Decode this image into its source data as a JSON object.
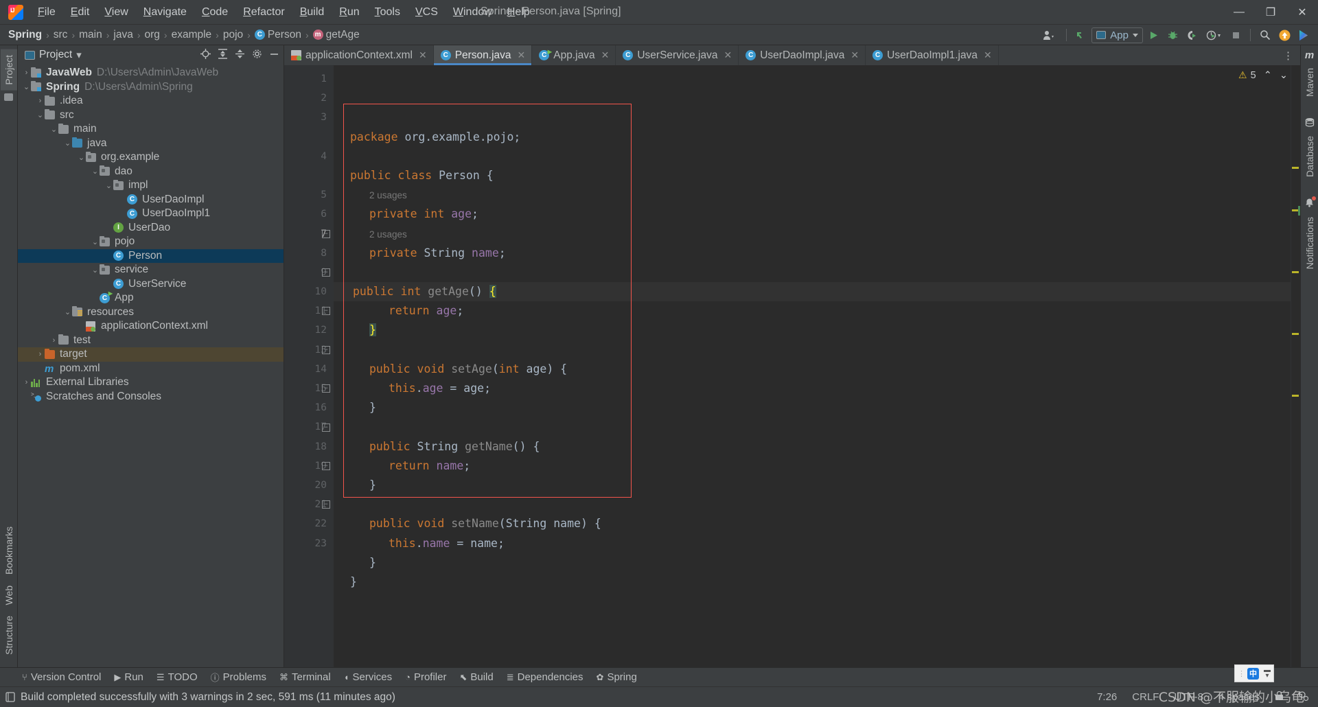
{
  "titlebar": {
    "logo": "intellij-idea-logo",
    "window_title": "Spring - Person.java [Spring]",
    "menus": [
      "File",
      "Edit",
      "View",
      "Navigate",
      "Code",
      "Refactor",
      "Build",
      "Run",
      "Tools",
      "VCS",
      "Window",
      "Help"
    ],
    "minimize": "—",
    "maximize": "❐",
    "close": "✕"
  },
  "navbar": {
    "breadcrumb": [
      {
        "label": "Spring",
        "bold": true,
        "icon": ""
      },
      {
        "label": "src",
        "bold": false,
        "icon": ""
      },
      {
        "label": "main",
        "bold": false,
        "icon": ""
      },
      {
        "label": "java",
        "bold": false,
        "icon": ""
      },
      {
        "label": "org",
        "bold": false,
        "icon": ""
      },
      {
        "label": "example",
        "bold": false,
        "icon": ""
      },
      {
        "label": "pojo",
        "bold": false,
        "icon": ""
      },
      {
        "label": "Person",
        "bold": false,
        "icon": "class-icon",
        "icon_char": "C"
      },
      {
        "label": "getAge",
        "bold": false,
        "icon": "method-icon",
        "icon_char": "m"
      }
    ],
    "separator": "›",
    "toolbar": {
      "account_icon": "user-account-icon",
      "update_icon": "vcs-update-icon",
      "run_config_label": "App",
      "run_icon": "run-icon",
      "debug_icon": "debug-icon",
      "coverage_icon": "run-with-coverage-icon",
      "profiler_icon": "profiler-icon",
      "stop_icon": "stop-icon",
      "search_icon": "search-everywhere-icon",
      "updates_icon": "updates-available-icon",
      "ai_icon": "ai-assistant-icon"
    }
  },
  "left_strip": {
    "tabs": [
      {
        "label": "Project",
        "active": true,
        "icon": "project-icon"
      },
      {
        "label": "Bookmarks",
        "active": false,
        "icon": "bookmark-icon"
      },
      {
        "label": "Web",
        "active": false,
        "icon": "web-icon"
      },
      {
        "label": "Structure",
        "active": false,
        "icon": "structure-icon"
      }
    ]
  },
  "right_strip": {
    "tabs": [
      {
        "label": "Maven",
        "icon": "maven-icon"
      },
      {
        "label": "Database",
        "icon": "database-icon"
      },
      {
        "label": "Notifications",
        "icon": "notifications-icon"
      }
    ]
  },
  "project_panel": {
    "title": "Project",
    "dropdown_caret": "▾",
    "actions": [
      "locate-icon",
      "expand-all-icon",
      "collapse-all-icon",
      "settings-icon",
      "hide-icon"
    ],
    "tree": [
      {
        "indent": 0,
        "arrow": "›",
        "icon": "module-folder-icon",
        "name": "JavaWeb",
        "bold": true,
        "path": "D:\\Users\\Admin\\JavaWeb",
        "state": "normal"
      },
      {
        "indent": 0,
        "arrow": "⌄",
        "icon": "module-folder-icon",
        "name": "Spring",
        "bold": true,
        "path": "D:\\Users\\Admin\\Spring",
        "state": "normal"
      },
      {
        "indent": 1,
        "arrow": "›",
        "icon": "folder-icon",
        "name": ".idea",
        "bold": false,
        "path": "",
        "state": "normal"
      },
      {
        "indent": 1,
        "arrow": "⌄",
        "icon": "folder-icon",
        "name": "src",
        "bold": false,
        "path": "",
        "state": "normal"
      },
      {
        "indent": 2,
        "arrow": "⌄",
        "icon": "folder-icon",
        "name": "main",
        "bold": false,
        "path": "",
        "state": "normal"
      },
      {
        "indent": 3,
        "arrow": "⌄",
        "icon": "source-folder-icon",
        "name": "java",
        "bold": false,
        "path": "",
        "state": "normal"
      },
      {
        "indent": 4,
        "arrow": "⌄",
        "icon": "package-icon",
        "name": "org.example",
        "bold": false,
        "path": "",
        "state": "normal"
      },
      {
        "indent": 5,
        "arrow": "⌄",
        "icon": "package-icon",
        "name": "dao",
        "bold": false,
        "path": "",
        "state": "normal"
      },
      {
        "indent": 6,
        "arrow": "⌄",
        "icon": "package-icon",
        "name": "impl",
        "bold": false,
        "path": "",
        "state": "normal"
      },
      {
        "indent": 7,
        "arrow": "",
        "icon": "class-icon",
        "name": "UserDaoImpl",
        "bold": false,
        "path": "",
        "state": "normal"
      },
      {
        "indent": 7,
        "arrow": "",
        "icon": "class-icon",
        "name": "UserDaoImpl1",
        "bold": false,
        "path": "",
        "state": "normal"
      },
      {
        "indent": 6,
        "arrow": "",
        "icon": "interface-icon",
        "name": "UserDao",
        "bold": false,
        "path": "",
        "state": "normal"
      },
      {
        "indent": 5,
        "arrow": "⌄",
        "icon": "package-icon",
        "name": "pojo",
        "bold": false,
        "path": "",
        "state": "normal"
      },
      {
        "indent": 6,
        "arrow": "",
        "icon": "class-icon",
        "name": "Person",
        "bold": false,
        "path": "",
        "state": "selected"
      },
      {
        "indent": 5,
        "arrow": "⌄",
        "icon": "package-icon",
        "name": "service",
        "bold": false,
        "path": "",
        "state": "normal"
      },
      {
        "indent": 6,
        "arrow": "",
        "icon": "class-icon",
        "name": "UserService",
        "bold": false,
        "path": "",
        "state": "normal"
      },
      {
        "indent": 5,
        "arrow": "",
        "icon": "runnable-class-icon",
        "name": "App",
        "bold": false,
        "path": "",
        "state": "normal"
      },
      {
        "indent": 3,
        "arrow": "⌄",
        "icon": "resources-folder-icon",
        "name": "resources",
        "bold": false,
        "path": "",
        "state": "normal"
      },
      {
        "indent": 4,
        "arrow": "",
        "icon": "spring-xml-icon",
        "name": "applicationContext.xml",
        "bold": false,
        "path": "",
        "state": "normal"
      },
      {
        "indent": 2,
        "arrow": "›",
        "icon": "folder-icon",
        "name": "test",
        "bold": false,
        "path": "",
        "state": "normal"
      },
      {
        "indent": 1,
        "arrow": "›",
        "icon": "excluded-folder-icon",
        "name": "target",
        "bold": false,
        "path": "",
        "state": "highlight"
      },
      {
        "indent": 1,
        "arrow": "",
        "icon": "maven-pom-icon",
        "name": "pom.xml",
        "bold": false,
        "path": "",
        "state": "normal"
      },
      {
        "indent": 0,
        "arrow": "›",
        "icon": "external-libraries-icon",
        "name": "External Libraries",
        "bold": false,
        "path": "",
        "state": "normal"
      },
      {
        "indent": 0,
        "arrow": "",
        "icon": "scratches-icon",
        "name": "Scratches and Consoles",
        "bold": false,
        "path": "",
        "state": "normal"
      }
    ]
  },
  "editor": {
    "tabs": [
      {
        "label": "applicationContext.xml",
        "icon": "spring-xml-icon",
        "active": false,
        "close": "✕"
      },
      {
        "label": "Person.java",
        "icon": "class-icon",
        "active": true,
        "close": "✕"
      },
      {
        "label": "App.java",
        "icon": "runnable-class-icon",
        "active": false,
        "close": "✕"
      },
      {
        "label": "UserService.java",
        "icon": "class-icon",
        "active": false,
        "close": "✕"
      },
      {
        "label": "UserDaoImpl.java",
        "icon": "class-icon",
        "active": false,
        "close": "✕"
      },
      {
        "label": "UserDaoImpl1.java",
        "icon": "class-icon",
        "active": false,
        "close": "✕"
      }
    ],
    "more_icon": "⋮",
    "warnings": {
      "count": "5",
      "icon": "warning-triangle-icon",
      "up": "⌃",
      "down": "⌄"
    },
    "line_numbers": [
      "1",
      "2",
      "3",
      "4",
      "5",
      "6",
      "7",
      "8",
      "9",
      "10",
      "11",
      "12",
      "13",
      "14",
      "15",
      "16",
      "17",
      "18",
      "19",
      "20",
      "21",
      "22",
      "23"
    ],
    "code_lines": [
      {
        "n": 1,
        "indent": 0,
        "tokens": [
          {
            "t": "package",
            "c": "kw"
          },
          {
            "t": " org.example.pojo;",
            "c": "plain"
          }
        ]
      },
      {
        "n": 2,
        "indent": 0,
        "tokens": []
      },
      {
        "n": 3,
        "indent": 0,
        "tokens": [
          {
            "t": "public class",
            "c": "kw"
          },
          {
            "t": " Person {",
            "c": "plain"
          }
        ]
      },
      {
        "n": null,
        "indent": 1,
        "usage": "2 usages"
      },
      {
        "n": 4,
        "indent": 1,
        "tokens": [
          {
            "t": "private int",
            "c": "kw"
          },
          {
            "t": " ",
            "c": "plain"
          },
          {
            "t": "age",
            "c": "fld"
          },
          {
            "t": ";",
            "c": "plain"
          }
        ]
      },
      {
        "n": null,
        "indent": 1,
        "usage": "2 usages"
      },
      {
        "n": 5,
        "indent": 1,
        "tokens": [
          {
            "t": "private",
            "c": "kw"
          },
          {
            "t": " String ",
            "c": "plain"
          },
          {
            "t": "name",
            "c": "fld"
          },
          {
            "t": ";",
            "c": "plain"
          }
        ]
      },
      {
        "n": 6,
        "indent": 0,
        "tokens": []
      },
      {
        "n": 7,
        "indent": 1,
        "current": true,
        "tokens": [
          {
            "t": "public int",
            "c": "kw"
          },
          {
            "t": " ",
            "c": "plain"
          },
          {
            "t": "getAge",
            "c": "mth-dim"
          },
          {
            "t": "() ",
            "c": "plain"
          },
          {
            "t": "{",
            "c": "brace"
          }
        ]
      },
      {
        "n": 8,
        "indent": 2,
        "tokens": [
          {
            "t": "return",
            "c": "kw"
          },
          {
            "t": " ",
            "c": "plain"
          },
          {
            "t": "age",
            "c": "fld"
          },
          {
            "t": ";",
            "c": "plain"
          }
        ]
      },
      {
        "n": 9,
        "indent": 1,
        "tokens": [
          {
            "t": "}",
            "c": "brace"
          }
        ]
      },
      {
        "n": 10,
        "indent": 0,
        "tokens": []
      },
      {
        "n": 11,
        "indent": 1,
        "tokens": [
          {
            "t": "public void",
            "c": "kw"
          },
          {
            "t": " ",
            "c": "plain"
          },
          {
            "t": "setAge",
            "c": "mth-dim"
          },
          {
            "t": "(",
            "c": "plain"
          },
          {
            "t": "int",
            "c": "kw"
          },
          {
            "t": " age) {",
            "c": "plain"
          }
        ]
      },
      {
        "n": 12,
        "indent": 2,
        "tokens": [
          {
            "t": "this",
            "c": "kw"
          },
          {
            "t": ".",
            "c": "plain"
          },
          {
            "t": "age",
            "c": "fld"
          },
          {
            "t": " = age;",
            "c": "plain"
          }
        ]
      },
      {
        "n": 13,
        "indent": 1,
        "tokens": [
          {
            "t": "}",
            "c": "plain"
          }
        ]
      },
      {
        "n": 14,
        "indent": 0,
        "tokens": []
      },
      {
        "n": 15,
        "indent": 1,
        "tokens": [
          {
            "t": "public",
            "c": "kw"
          },
          {
            "t": " String ",
            "c": "plain"
          },
          {
            "t": "getName",
            "c": "mth-dim"
          },
          {
            "t": "() {",
            "c": "plain"
          }
        ]
      },
      {
        "n": 16,
        "indent": 2,
        "tokens": [
          {
            "t": "return",
            "c": "kw"
          },
          {
            "t": " ",
            "c": "plain"
          },
          {
            "t": "name",
            "c": "fld"
          },
          {
            "t": ";",
            "c": "plain"
          }
        ]
      },
      {
        "n": 17,
        "indent": 1,
        "tokens": [
          {
            "t": "}",
            "c": "plain"
          }
        ]
      },
      {
        "n": 18,
        "indent": 0,
        "tokens": []
      },
      {
        "n": 19,
        "indent": 1,
        "tokens": [
          {
            "t": "public void",
            "c": "kw"
          },
          {
            "t": " ",
            "c": "plain"
          },
          {
            "t": "setName",
            "c": "mth-dim"
          },
          {
            "t": "(String name) {",
            "c": "plain"
          }
        ]
      },
      {
        "n": 20,
        "indent": 2,
        "tokens": [
          {
            "t": "this",
            "c": "kw"
          },
          {
            "t": ".",
            "c": "plain"
          },
          {
            "t": "name",
            "c": "fld"
          },
          {
            "t": " = name;",
            "c": "plain"
          }
        ]
      },
      {
        "n": 21,
        "indent": 1,
        "tokens": [
          {
            "t": "}",
            "c": "plain"
          }
        ]
      },
      {
        "n": 22,
        "indent": 0,
        "tokens": [
          {
            "t": "}",
            "c": "plain"
          }
        ]
      },
      {
        "n": 23,
        "indent": 0,
        "tokens": []
      }
    ],
    "annotation_box": "red-selection-rectangle"
  },
  "bottom": {
    "tool_windows": [
      {
        "label": "Version Control",
        "icon": "branch-icon"
      },
      {
        "label": "Run",
        "icon": "run-icon"
      },
      {
        "label": "TODO",
        "icon": "todo-icon"
      },
      {
        "label": "Problems",
        "icon": "problems-icon"
      },
      {
        "label": "Terminal",
        "icon": "terminal-icon"
      },
      {
        "label": "Services",
        "icon": "services-icon"
      },
      {
        "label": "Profiler",
        "icon": "profiler-icon"
      },
      {
        "label": "Build",
        "icon": "build-icon"
      },
      {
        "label": "Dependencies",
        "icon": "dependencies-icon"
      },
      {
        "label": "Spring",
        "icon": "spring-icon"
      }
    ],
    "status": {
      "icon": "build-status-icon",
      "message": "Build completed successfully with 3 warnings in 2 sec, 591 ms (11 minutes ago)",
      "caret_position": "7:26",
      "line_separator": "CRLF",
      "encoding": "UTF-8",
      "indent": "4 spaces",
      "lock_icon": "read-only-icon",
      "inspections_icon": "inspections-icon"
    },
    "watermark": "CSDN @不服输的小乌龟",
    "ime": {
      "icon": "ime-chinese-icon",
      "caret": "▾",
      "dots": "⫶"
    }
  },
  "colors": {
    "bg_panel": "#3c3f41",
    "bg_editor": "#2b2b2b",
    "accent_blue": "#4a88c7",
    "selection": "#0d3a58",
    "keyword": "#cc7832",
    "field": "#9876aa",
    "plain": "#a9b7c6",
    "annotation_red": "#f4554c",
    "warning_yellow": "#bbb529"
  }
}
